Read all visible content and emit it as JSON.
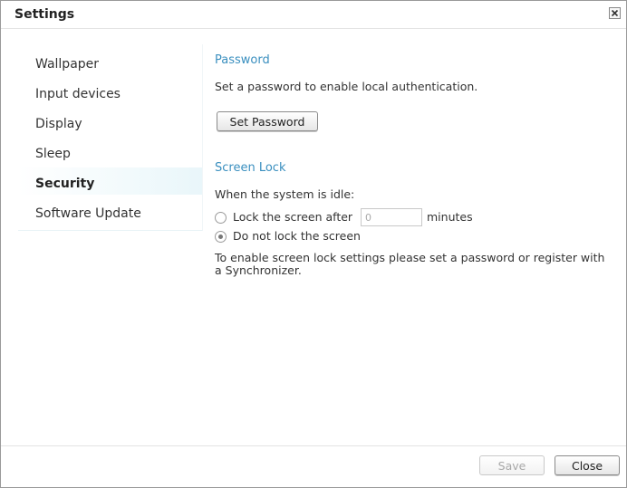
{
  "window": {
    "title": "Settings",
    "close_icon": "close-icon"
  },
  "sidebar": {
    "items": [
      {
        "label": "Wallpaper"
      },
      {
        "label": "Input devices"
      },
      {
        "label": "Display"
      },
      {
        "label": "Sleep"
      },
      {
        "label": "Security",
        "active": true
      },
      {
        "label": "Software Update"
      }
    ]
  },
  "password": {
    "title": "Password",
    "description": "Set a password to enable local authentication.",
    "button_label": "Set Password"
  },
  "screen_lock": {
    "title": "Screen Lock",
    "idle_label": "When the system is idle:",
    "option_lock_label": "Lock the screen after",
    "minutes_placeholder": "0",
    "minutes_label": "minutes",
    "option_no_lock_label": "Do not lock the screen",
    "selected_option": "no_lock",
    "note_line1": "To enable screen lock settings please set a password or register with",
    "note_line2": "a Synchronizer."
  },
  "footer": {
    "save_label": "Save",
    "close_label": "Close"
  }
}
